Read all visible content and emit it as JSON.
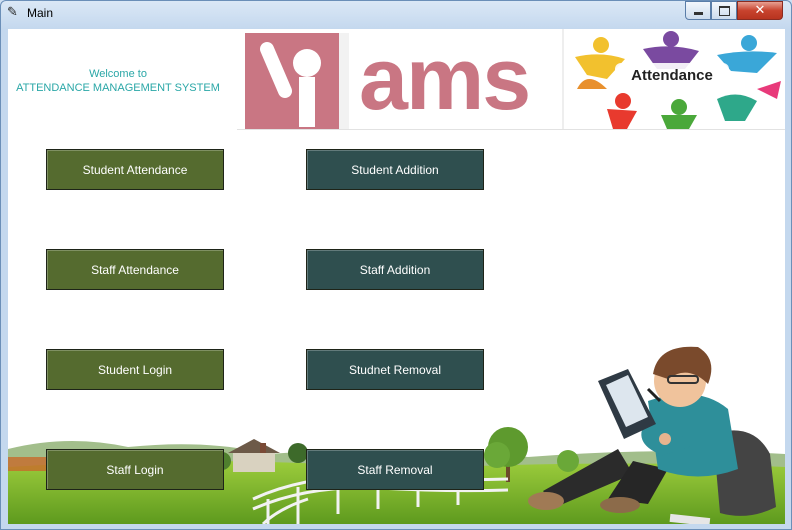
{
  "window": {
    "title": "Main",
    "app_icon": "feather-icon",
    "controls": {
      "minimize": "minimize-icon",
      "maximize": "maximize-icon",
      "close": "close-icon"
    }
  },
  "header": {
    "welcome_line1": "Welcome to",
    "welcome_line2": "ATTENDANCE MANAGEMENT SYSTEM",
    "logo_text": "ams",
    "attendance_logo_text": "Attendance"
  },
  "buttons": {
    "student_attendance": "Student Attendance",
    "student_addition": "Student Addition",
    "staff_attendance": "Staff Attendance",
    "staff_addition": "Staff Addition",
    "student_login": "Student Login",
    "student_removal": "Studnet Removal",
    "staff_login": "Staff Login",
    "staff_removal": "Staff Removal"
  },
  "colors": {
    "olive_button": "#556b2f",
    "slate_button": "#2f4f4f",
    "welcome_text": "#2aa7a7",
    "logo_pink": "#c97683"
  }
}
